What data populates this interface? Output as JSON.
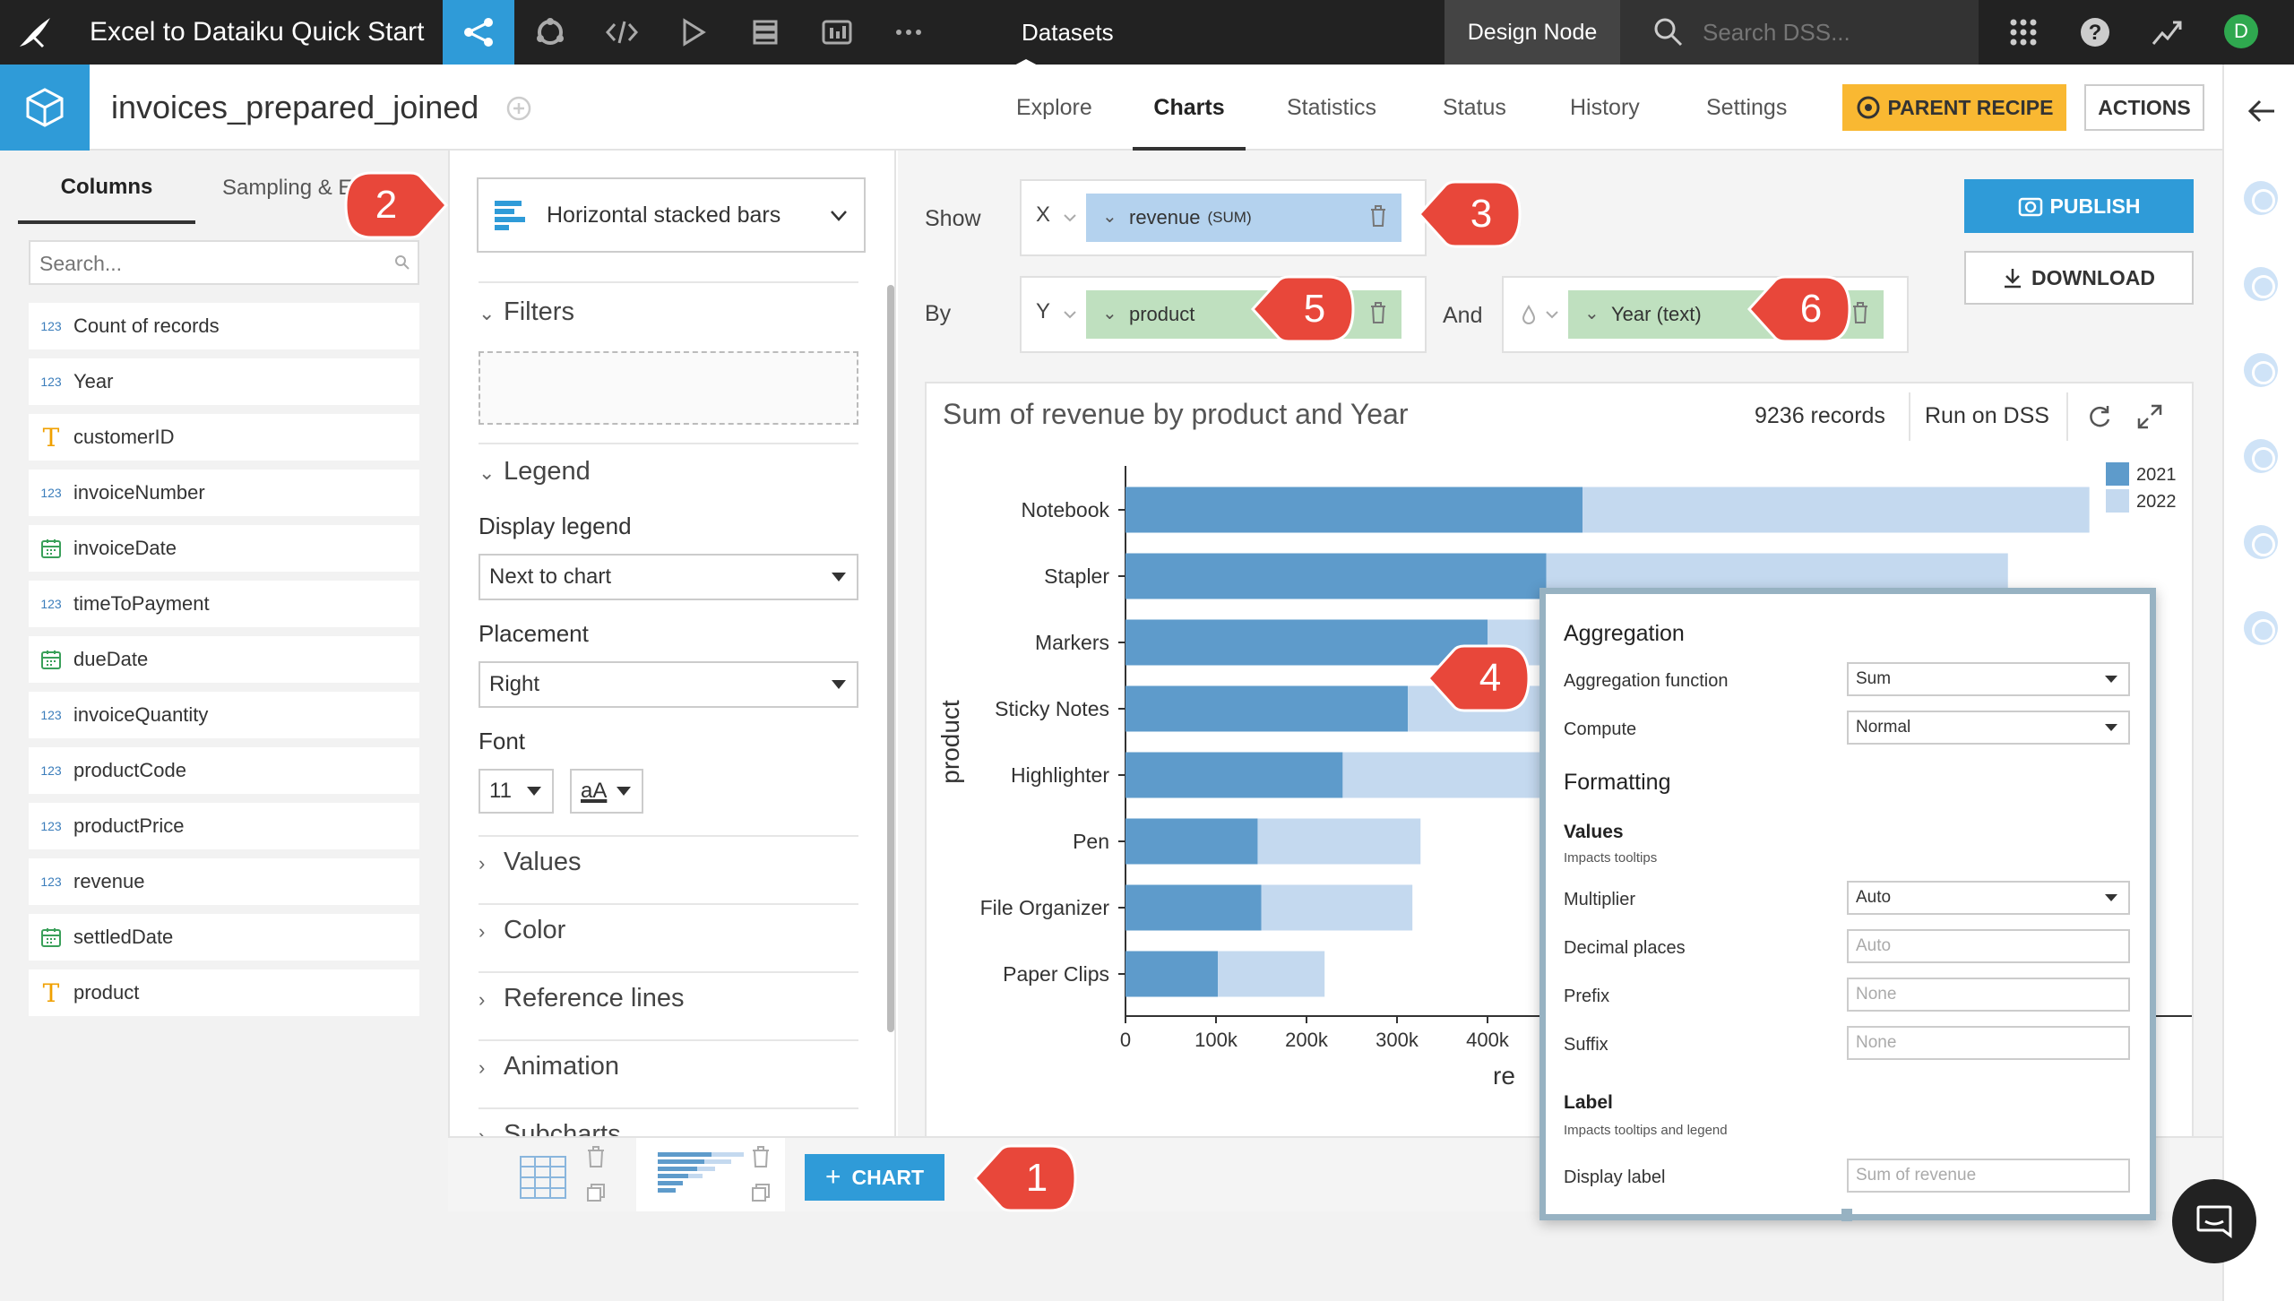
{
  "topbar": {
    "project_title": "Excel to Dataiku Quick Start",
    "section": "Datasets",
    "node_badge": "Design Node",
    "search_placeholder": "Search DSS...",
    "user_initial": "D",
    "icons": [
      "flow-icon",
      "recipes-icon",
      "code-icon",
      "run-icon",
      "deploy-icon",
      "dashboard-icon",
      "more-icon"
    ]
  },
  "dataset": {
    "name": "invoices_prepared_joined",
    "tabs": [
      "Explore",
      "Charts",
      "Statistics",
      "Status",
      "History",
      "Settings"
    ],
    "active_tab": "Charts",
    "parent_recipe_label": "PARENT RECIPE",
    "actions_label": "ACTIONS"
  },
  "left_panel": {
    "tabs": [
      "Columns",
      "Sampling & En"
    ],
    "search_placeholder": "Search...",
    "columns": [
      {
        "type": "123",
        "name": "Count of records"
      },
      {
        "type": "123",
        "name": "Year"
      },
      {
        "type": "T",
        "name": "customerID"
      },
      {
        "type": "123",
        "name": "invoiceNumber"
      },
      {
        "type": "date",
        "name": "invoiceDate"
      },
      {
        "type": "123",
        "name": "timeToPayment"
      },
      {
        "type": "date",
        "name": "dueDate"
      },
      {
        "type": "123",
        "name": "invoiceQuantity"
      },
      {
        "type": "123",
        "name": "productCode"
      },
      {
        "type": "123",
        "name": "productPrice"
      },
      {
        "type": "123",
        "name": "revenue"
      },
      {
        "type": "date",
        "name": "settledDate"
      },
      {
        "type": "T",
        "name": "product"
      }
    ]
  },
  "settings": {
    "chart_type": "Horizontal stacked bars",
    "filters_label": "Filters",
    "legend_label": "Legend",
    "display_legend_label": "Display legend",
    "display_legend_value": "Next to chart",
    "placement_label": "Placement",
    "placement_value": "Right",
    "font_label": "Font",
    "font_size": "11",
    "font_style": "aA",
    "sections": [
      "Values",
      "Color",
      "Reference lines",
      "Animation",
      "Subcharts"
    ]
  },
  "shelves": {
    "show_label": "Show",
    "by_label": "By",
    "and_label": "And",
    "x_axis": "X",
    "y_axis": "Y",
    "x_measure": "revenue",
    "x_agg": "(SUM)",
    "y_dim": "product",
    "color_dim": "Year (text)"
  },
  "buttons": {
    "publish": "PUBLISH",
    "download": "DOWNLOAD",
    "add_chart": "CHART"
  },
  "chart_header": {
    "title": "Sum of revenue by product and Year",
    "records": "9236 records",
    "run_on": "Run on DSS"
  },
  "chart_data": {
    "type": "bar",
    "orientation": "horizontal",
    "stacked": true,
    "title": "Sum of revenue by product and Year",
    "ylabel": "product",
    "xlabel": "re",
    "categories": [
      "Notebook",
      "Stapler",
      "Markers",
      "Sticky Notes",
      "Highlighter",
      "Pen",
      "File Organizer",
      "Paper Clips"
    ],
    "series": [
      {
        "name": "2021",
        "color": "#5e9bcb",
        "values": [
          505000,
          465000,
          400000,
          312000,
          240000,
          146000,
          150000,
          102000
        ]
      },
      {
        "name": "2022",
        "color": "#c4d9ef",
        "values": [
          560000,
          510000,
          430000,
          330000,
          260000,
          180000,
          167000,
          118000
        ]
      }
    ],
    "x_ticks": [
      "0",
      "100k",
      "200k",
      "300k",
      "400k"
    ],
    "x_tick_values": [
      0,
      100000,
      200000,
      300000,
      400000
    ],
    "legend_position": "top-right"
  },
  "popover": {
    "aggregation_heading": "Aggregation",
    "aggregation_function_label": "Aggregation function",
    "aggregation_function_value": "Sum",
    "compute_label": "Compute",
    "compute_value": "Normal",
    "formatting_heading": "Formatting",
    "values_heading": "Values",
    "values_note": "Impacts tooltips",
    "multiplier_label": "Multiplier",
    "multiplier_value": "Auto",
    "decimal_label": "Decimal places",
    "decimal_placeholder": "Auto",
    "prefix_label": "Prefix",
    "prefix_placeholder": "None",
    "suffix_label": "Suffix",
    "suffix_placeholder": "None",
    "label_heading": "Label",
    "label_note": "Impacts tooltips and legend",
    "display_label_label": "Display label",
    "display_label_placeholder": "Sum of revenue"
  },
  "callouts": [
    "1",
    "2",
    "3",
    "4",
    "5",
    "6"
  ],
  "colors": {
    "topbar": "#222222",
    "accent_blue": "#2f9bd8",
    "parent_recipe": "#f9b832",
    "measure_pill": "#b4d2ee",
    "dimension_pill": "#bfe0bf",
    "callout": "#e8473a"
  }
}
